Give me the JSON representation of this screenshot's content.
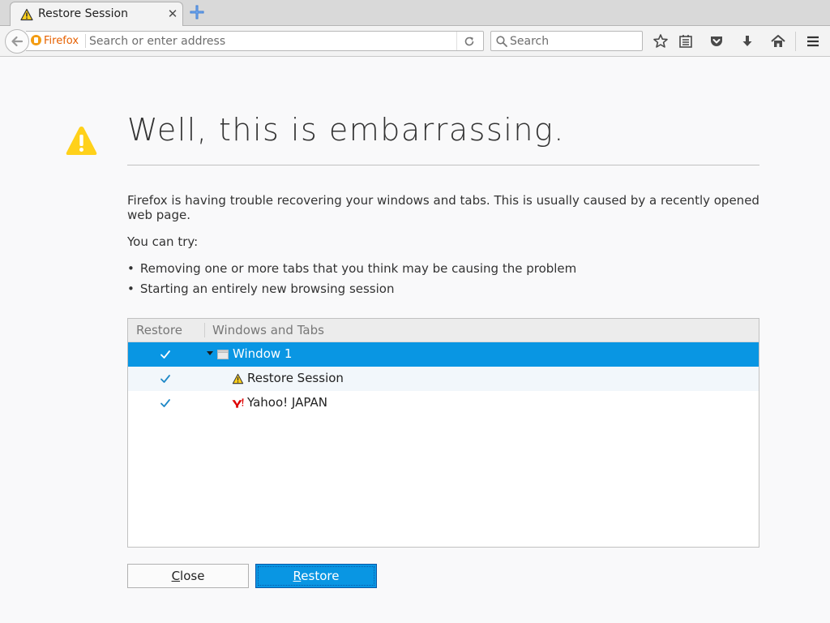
{
  "browser": {
    "tab": {
      "title": "Restore Session",
      "close_glyph": "✕",
      "icon": "warning-icon"
    },
    "urlbar": {
      "identity_label": "Firefox",
      "placeholder": "Search or enter address",
      "value": ""
    },
    "searchbar": {
      "placeholder": "Search",
      "value": ""
    },
    "toolbar_icons": [
      "back-icon",
      "reload-icon",
      "bookmark-star-icon",
      "reading-list-icon",
      "pocket-icon",
      "download-icon",
      "home-icon",
      "menu-icon"
    ]
  },
  "page": {
    "title": "Well, this is embarrassing.",
    "message": "Firefox is having trouble recovering your windows and tabs. This is usually caused by a recently opened web page.",
    "try_intro": "You can try:",
    "suggestions": [
      "Removing one or more tabs that you think may be causing the problem",
      "Starting an entirely new browsing session"
    ],
    "tree": {
      "columns": {
        "restore": "Restore",
        "windows": "Windows and Tabs"
      },
      "rows": [
        {
          "label": "Window 1",
          "checked": true,
          "type": "window",
          "selected": true
        },
        {
          "label": "Restore Session",
          "checked": true,
          "type": "tab",
          "favicon": "warning-icon"
        },
        {
          "label": "Yahoo! JAPAN",
          "checked": true,
          "type": "tab",
          "favicon": "yahoo-icon"
        }
      ]
    },
    "buttons": {
      "close": {
        "accesskey": "C",
        "rest": "lose"
      },
      "restore": {
        "accesskey": "R",
        "rest": "estore"
      }
    }
  },
  "colors": {
    "accent": "#0996e3",
    "warning": "#ffd11a",
    "firefox_orange": "#e66000"
  }
}
